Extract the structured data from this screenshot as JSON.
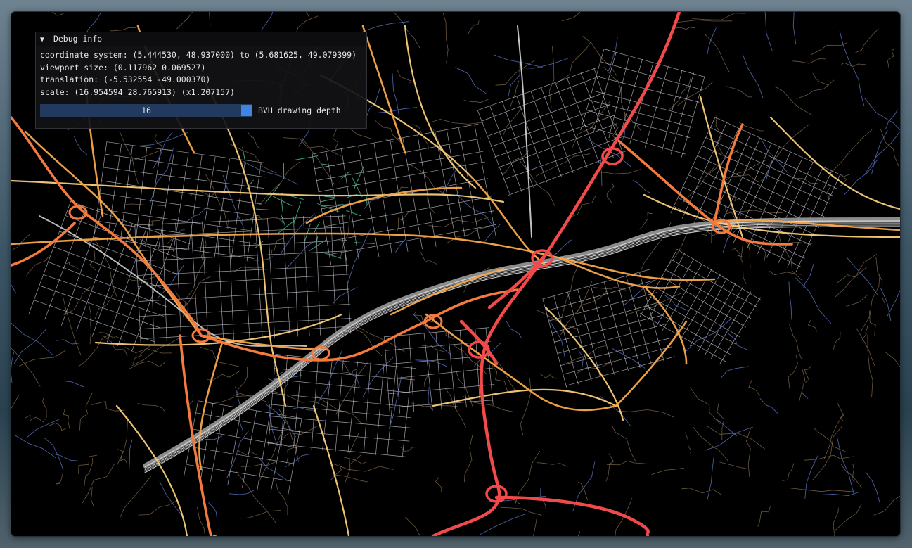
{
  "debug": {
    "title": "Debug info",
    "coordinate_system": "coordinate system: (5.444530, 48.937000) to (5.681625, 49.079399)",
    "viewport_size": "viewport size: (0.117962 0.069527)",
    "translation": "translation: (-5.532554 -49.000370)",
    "scale": "scale: (16.954594 28.765913) (x1.207157)",
    "bvh_depth_value": "16",
    "bvh_depth_label": "BVH drawing depth"
  },
  "colors": {
    "motorway": "#f24a4a",
    "trunk": "#f57a3d",
    "primary": "#f7a64a",
    "secondary": "#f9cc7a",
    "tertiary": "#ffffff",
    "residential": "#b8b8c2",
    "minor": "#8e7454",
    "service": "#5a74c4",
    "path": "#3fae8a",
    "slider_fill": "#223a5e",
    "slider_grab": "#3d85e0"
  },
  "icons": {
    "collapse": "triangle-down-icon"
  }
}
